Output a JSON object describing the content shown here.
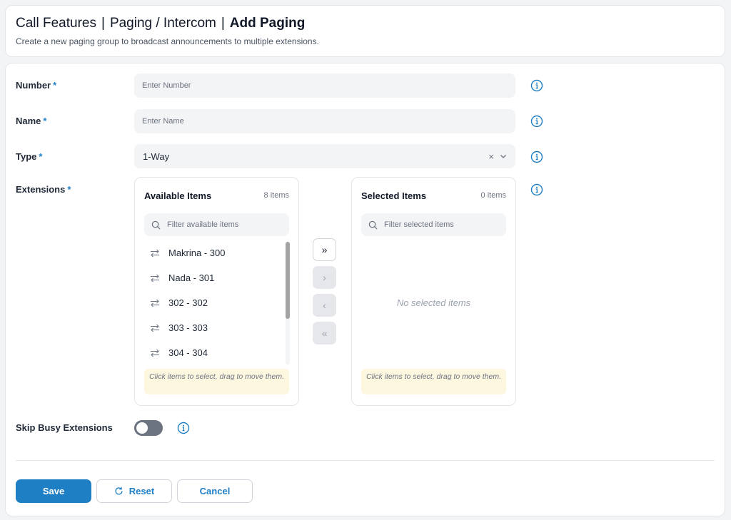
{
  "header": {
    "crumbs": [
      "Call Features",
      "Paging / Intercom"
    ],
    "current": "Add Paging",
    "separator": "|",
    "subtitle": "Create a new paging group to broadcast announcements to multiple extensions."
  },
  "form": {
    "number": {
      "label": "Number",
      "required": "*",
      "placeholder": "Enter Number"
    },
    "name": {
      "label": "Name",
      "required": "*",
      "placeholder": "Enter Name"
    },
    "type": {
      "label": "Type",
      "required": "*",
      "value": "1-Way",
      "clear": "×"
    },
    "extensions": {
      "label": "Extensions",
      "required": "*"
    },
    "skip_busy": {
      "label": "Skip Busy Extensions",
      "enabled": false
    }
  },
  "available": {
    "title": "Available Items",
    "count": "8 items",
    "filter_placeholder": "Filter available items",
    "items": [
      "Makrina - 300",
      "Nada - 301",
      "302 - 302",
      "303 - 303",
      "304 - 304"
    ],
    "hint": "Click items to select, drag to move them."
  },
  "selected": {
    "title": "Selected Items",
    "count": "0 items",
    "filter_placeholder": "Filter selected items",
    "empty": "No selected items",
    "hint": "Click items to select, drag to move them."
  },
  "transfer": {
    "move_all": "»",
    "move_one": "›",
    "back_one": "‹",
    "back_all": "«"
  },
  "actions": {
    "save": "Save",
    "reset": "Reset",
    "cancel": "Cancel"
  },
  "colors": {
    "accent": "#1f7fc4",
    "toggle_off": "#6b7280",
    "hint_bg": "#fef7e0"
  }
}
